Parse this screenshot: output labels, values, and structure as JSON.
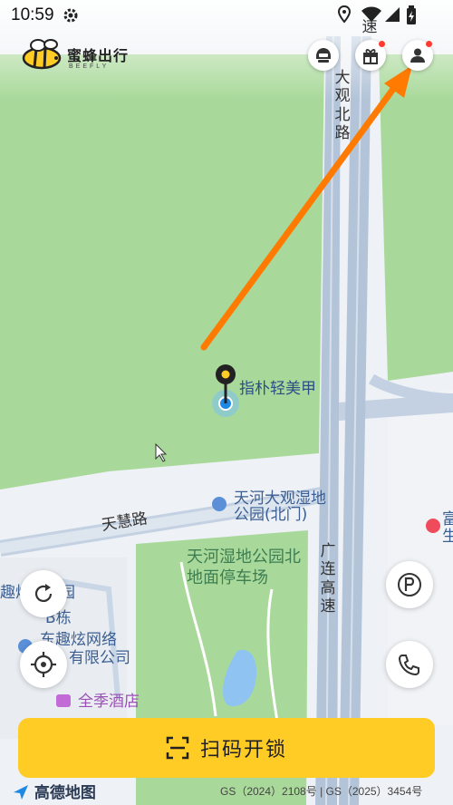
{
  "status_bar": {
    "time": "10:59"
  },
  "header": {
    "app_name": "蜜蜂出行",
    "app_subtitle": "BEEFLY"
  },
  "map": {
    "road_north": "大观北路",
    "road_north_top": "速",
    "marker_label": "指朴轻美甲",
    "poi_park": "天河大观湿地公园(北门)",
    "road_tianhui": "天慧路",
    "parking_lot": "天河湿地公园北地面停车场",
    "expressway": "广连高速",
    "poi_left_1": "趣炫",
    "poi_left_1b": "园",
    "poi_left_2": "B栋",
    "poi_company": "广东趣炫网络有限公司",
    "poi_company_line1": "东趣炫网络",
    "poi_company_line2": "有限公司",
    "poi_hotel": "全季酒店",
    "poi_right_1": "富",
    "poi_right_2": "生",
    "poi_bottom": "地"
  },
  "actions": {
    "scan_label": "扫码开锁"
  },
  "footer": {
    "amap_label": "高德地图",
    "license": "GS（2024）2108号 | GS（2025）3454号"
  },
  "colors": {
    "park_green": "#a9d99a",
    "road_blue": "#b8c8db",
    "scan_yellow": "#ffcb25",
    "arrow_orange": "#ff7a00",
    "notify_red": "#ff3b30"
  }
}
